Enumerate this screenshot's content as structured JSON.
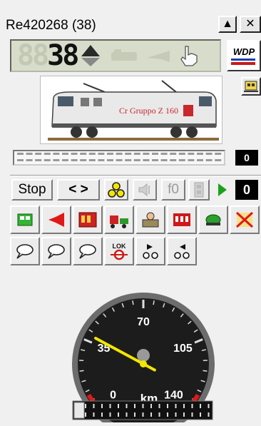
{
  "window": {
    "title": "Re420268 (38)",
    "up_label": "▲",
    "close_label": "✕"
  },
  "speed_display": {
    "ghost_digits": "88",
    "speed": "38",
    "direction": "forward"
  },
  "wdp_label": "WDP",
  "loco": {
    "livery_text": "Cr Gruppo Z 160"
  },
  "progress": {
    "value": "0"
  },
  "controls": {
    "stop_label": "Stop",
    "direction_label": "< >",
    "f0_label": "f0",
    "counter_value": "0"
  },
  "function_rows": [
    [
      "locomotive-icon",
      "horn-icon",
      "carriage-icon",
      "train-icon",
      "driver-icon",
      "red-coach-icon",
      "turtle-icon",
      "no-coupling-icon"
    ],
    [
      "speech-bubble-icon",
      "speech-bubble-icon",
      "speech-bubble-icon",
      "lok-icon",
      "shunt-forward-icon",
      "shunt-back-icon"
    ]
  ],
  "lok_label": "LOK",
  "gauge": {
    "unit": "km",
    "ticks": [
      "0",
      "35",
      "70",
      "105",
      "140"
    ],
    "max": 140,
    "value": 38,
    "needle_color": "#f2e600"
  }
}
